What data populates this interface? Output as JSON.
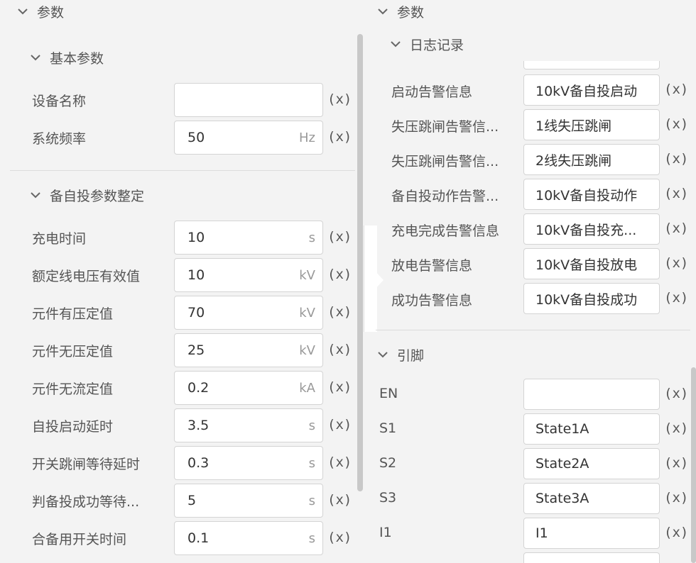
{
  "left": {
    "header": "参数",
    "basic": {
      "title": "基本参数",
      "rows": [
        {
          "label": "设备名称",
          "value": "",
          "unit": ""
        },
        {
          "label": "系统频率",
          "value": "50",
          "unit": "Hz"
        }
      ]
    },
    "backup": {
      "title": "备自投参数整定",
      "rows": [
        {
          "label": "充电时间",
          "value": "10",
          "unit": "s"
        },
        {
          "label": "额定线电压有效值",
          "value": "10",
          "unit": "kV"
        },
        {
          "label": "元件有压定值",
          "value": "70",
          "unit": "kV"
        },
        {
          "label": "元件无压定值",
          "value": "25",
          "unit": "kV"
        },
        {
          "label": "元件无流定值",
          "value": "0.2",
          "unit": "kA"
        },
        {
          "label": "自投启动延时",
          "value": "3.5",
          "unit": "s"
        },
        {
          "label": "开关跳闸等待延时",
          "value": "0.3",
          "unit": "s"
        },
        {
          "label": "判备投成功等待...",
          "value": "5",
          "unit": "s"
        },
        {
          "label": "合备用开关时间",
          "value": "0.1",
          "unit": "s"
        }
      ]
    }
  },
  "right": {
    "header": "参数",
    "log": {
      "title": "日志记录",
      "rows": [
        {
          "label": "启动告警信息",
          "value": "10kV备自投启动"
        },
        {
          "label": "失压跳闸告警信...",
          "value": "1线失压跳闸"
        },
        {
          "label": "失压跳闸告警信...",
          "value": "2线失压跳闸"
        },
        {
          "label": "备自投动作告警...",
          "value": "10kV备自投动作"
        },
        {
          "label": "充电完成告警信息",
          "value": "10kV备自投充..."
        },
        {
          "label": "放电告警信息",
          "value": "10kV备自投放电"
        },
        {
          "label": "成功告警信息",
          "value": "10kV备自投成功"
        }
      ]
    },
    "pins": {
      "title": "引脚",
      "rows": [
        {
          "label": "EN",
          "value": ""
        },
        {
          "label": "S1",
          "value": "State1A"
        },
        {
          "label": "S2",
          "value": "State2A"
        },
        {
          "label": "S3",
          "value": "State3A"
        },
        {
          "label": "I1",
          "value": "I1"
        }
      ]
    }
  },
  "x_label": "(x)"
}
